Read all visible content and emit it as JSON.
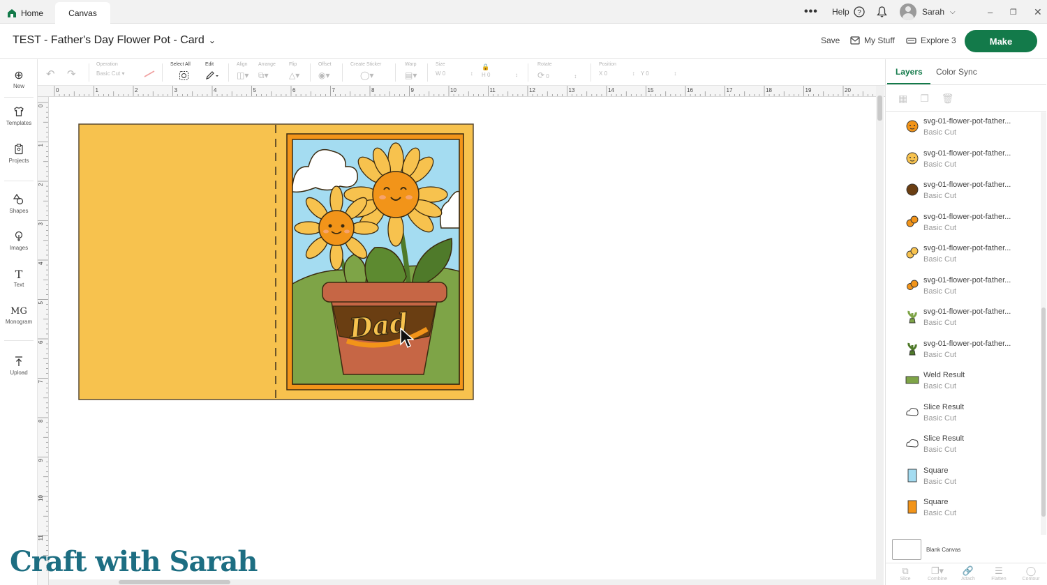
{
  "titlebar": {
    "tabs": [
      {
        "label": "Home"
      },
      {
        "label": "Canvas"
      }
    ],
    "help_label": "Help",
    "user_name": "Sarah"
  },
  "header": {
    "project_title": "TEST - Father's Day Flower Pot - Card",
    "save_label": "Save",
    "my_stuff_label": "My Stuff",
    "machine_label": "Explore 3",
    "make_label": "Make"
  },
  "toolbar": {
    "operation_label": "Operation",
    "operation_value": "Basic Cut",
    "select_all_label": "Select All",
    "edit_label": "Edit",
    "align_label": "Align",
    "arrange_label": "Arrange",
    "flip_label": "Flip",
    "offset_label": "Offset",
    "sticker_label": "Create Sticker",
    "warp_label": "Warp",
    "size_label": "Size",
    "w_label": "W",
    "h_label": "H",
    "rotate_label": "Rotate",
    "position_label": "Position",
    "x_label": "X",
    "y_label": "Y",
    "zero": "0"
  },
  "sidebar": {
    "items": [
      {
        "label": "New",
        "icon": "plus-circle-icon"
      },
      {
        "label": "Templates",
        "icon": "shirt-icon"
      },
      {
        "label": "Projects",
        "icon": "clipboard-icon"
      },
      {
        "label": "Shapes",
        "icon": "shapes-icon"
      },
      {
        "label": "Images",
        "icon": "lightbulb-icon"
      },
      {
        "label": "Text",
        "icon": "text-icon"
      },
      {
        "label": "Monogram",
        "icon": "monogram-icon"
      },
      {
        "label": "Upload",
        "icon": "upload-icon"
      }
    ]
  },
  "ruler": {
    "top": [
      "0",
      "1",
      "2",
      "3",
      "4",
      "5",
      "6",
      "7",
      "8",
      "9",
      "10",
      "11",
      "12",
      "13",
      "14",
      "15",
      "16",
      "17",
      "18",
      "19",
      "20"
    ],
    "left": [
      "0",
      "1",
      "2",
      "3",
      "4",
      "5",
      "6",
      "7",
      "8",
      "9",
      "10",
      "11"
    ]
  },
  "card": {
    "base_color": "#f7c24e",
    "frame_color": "#f29419",
    "sky_color": "#a4dcf1",
    "grass_color": "#7ea447",
    "pot_color": "#c66645",
    "text": "Dad"
  },
  "layers_panel": {
    "tabs": [
      {
        "label": "Layers"
      },
      {
        "label": "Color Sync"
      }
    ],
    "layers": [
      {
        "name": "svg-01-flower-pot-father...",
        "op": "Basic Cut",
        "color": "#f29419",
        "shape": "face"
      },
      {
        "name": "svg-01-flower-pot-father...",
        "op": "Basic Cut",
        "color": "#f7c24e",
        "shape": "face"
      },
      {
        "name": "svg-01-flower-pot-father...",
        "op": "Basic Cut",
        "color": "#6a3e12",
        "shape": "circle"
      },
      {
        "name": "svg-01-flower-pot-father...",
        "op": "Basic Cut",
        "color": "#f29419",
        "shape": "flowers"
      },
      {
        "name": "svg-01-flower-pot-father...",
        "op": "Basic Cut",
        "color": "#f7c24e",
        "shape": "flowers"
      },
      {
        "name": "svg-01-flower-pot-father...",
        "op": "Basic Cut",
        "color": "#f29419",
        "shape": "blobs"
      },
      {
        "name": "svg-01-flower-pot-father...",
        "op": "Basic Cut",
        "color": "#7ea447",
        "shape": "plant"
      },
      {
        "name": "svg-01-flower-pot-father...",
        "op": "Basic Cut",
        "color": "#4f7a2a",
        "shape": "plant"
      },
      {
        "name": "Weld Result",
        "op": "Basic Cut",
        "color": "#7ea447",
        "shape": "rect"
      },
      {
        "name": "Slice Result",
        "op": "Basic Cut",
        "color": "#ffffff",
        "shape": "cloud"
      },
      {
        "name": "Slice Result",
        "op": "Basic Cut",
        "color": "#ffffff",
        "shape": "cloud"
      },
      {
        "name": "Square",
        "op": "Basic Cut",
        "color": "#a4dcf1",
        "shape": "tall"
      },
      {
        "name": "Square",
        "op": "Basic Cut",
        "color": "#f29419",
        "shape": "tall"
      }
    ],
    "blank_canvas_label": "Blank Canvas",
    "bottom_tools": [
      {
        "label": "Slice"
      },
      {
        "label": "Combine"
      },
      {
        "label": "Attach"
      },
      {
        "label": "Flatten"
      },
      {
        "label": "Contour"
      }
    ]
  },
  "watermark": "Craft with Sarah"
}
